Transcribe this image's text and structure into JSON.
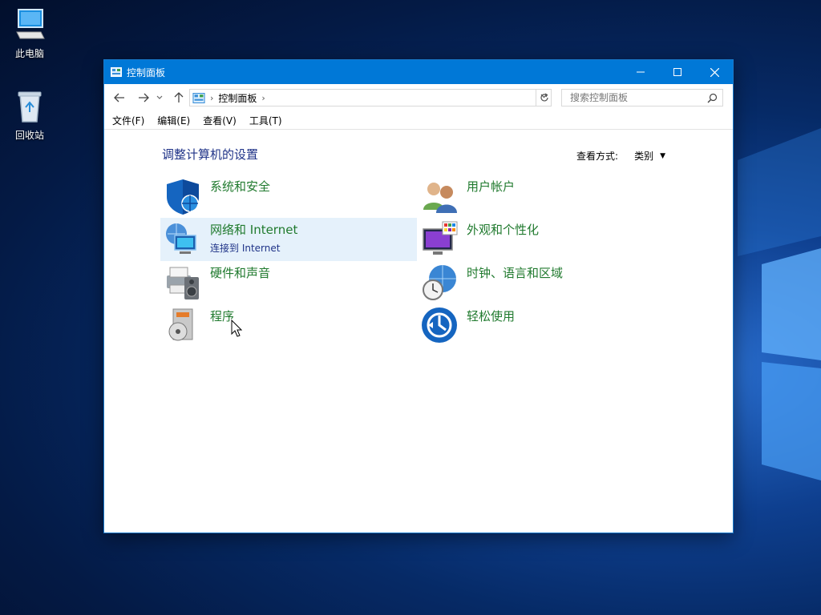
{
  "desktop": {
    "icons": [
      {
        "label": "此电脑",
        "icon": "computer-icon"
      },
      {
        "label": "回收站",
        "icon": "recycle-bin-icon"
      }
    ]
  },
  "window": {
    "title": "控制面板",
    "controls": [
      "minimize-icon",
      "maximize-icon",
      "close-icon"
    ],
    "address": {
      "segments": [
        "控制面板"
      ]
    },
    "search": {
      "placeholder": "搜索控制面板"
    },
    "menu": [
      "文件(F)",
      "编辑(E)",
      "查看(V)",
      "工具(T)"
    ],
    "heading": "调整计算机的设置",
    "view_by": {
      "label": "查看方式:",
      "value": "类别"
    },
    "categories": [
      {
        "title": "系统和安全",
        "icon": "shield-icon"
      },
      {
        "title": "用户帐户",
        "icon": "users-icon"
      },
      {
        "title": "网络和 Internet",
        "subtitle": "连接到 Internet",
        "icon": "network-icon",
        "hovered": true
      },
      {
        "title": "外观和个性化",
        "icon": "display-palette-icon"
      },
      {
        "title": "硬件和声音",
        "icon": "printer-speaker-icon"
      },
      {
        "title": "时钟、语言和区域",
        "icon": "globe-clock-icon"
      },
      {
        "title": "程序",
        "icon": "programs-icon"
      },
      {
        "title": "轻松使用",
        "icon": "ease-of-access-icon"
      }
    ]
  },
  "colors": {
    "titlebar": "#0078d7",
    "category_title": "#207a2e",
    "link": "#1e3287",
    "hover": "#e5f1fb"
  }
}
